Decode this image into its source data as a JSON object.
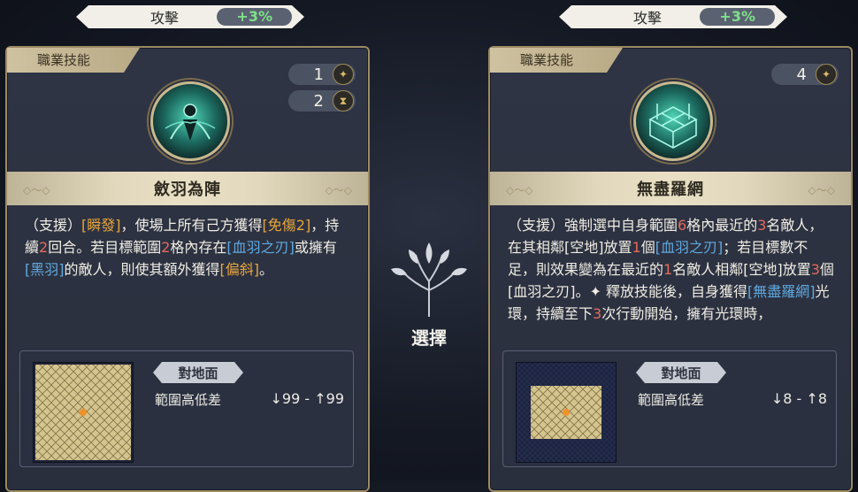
{
  "left_card": {
    "stat": {
      "name": "攻擊",
      "value": "+3%"
    },
    "category_label": "職業技能",
    "badges": [
      {
        "count": "1",
        "icon": "star-cost-icon"
      },
      {
        "count": "2",
        "icon": "hourglass-icon"
      }
    ],
    "skill_icon": "feather-array-skill-icon",
    "skill_name": "斂羽為陣",
    "description": [
      {
        "t": "（支援）",
        "c": ""
      },
      {
        "t": "[瞬發]",
        "c": "y"
      },
      {
        "t": "，使場上所有己方獲得",
        "c": ""
      },
      {
        "t": "[免傷2]",
        "c": "y"
      },
      {
        "t": "，持續",
        "c": ""
      },
      {
        "t": "2",
        "c": "r"
      },
      {
        "t": "回合。若目標範圍",
        "c": ""
      },
      {
        "t": "2",
        "c": "r"
      },
      {
        "t": "格內存在",
        "c": ""
      },
      {
        "t": "[血羽之刃]",
        "c": "b"
      },
      {
        "t": "或擁有",
        "c": ""
      },
      {
        "t": "[黑羽]",
        "c": "b"
      },
      {
        "t": "的敵人，則使其額外獲得",
        "c": ""
      },
      {
        "t": "[偏斜]",
        "c": "y"
      },
      {
        "t": "。",
        "c": ""
      }
    ],
    "range": {
      "terrain_label": "對地面",
      "height_label": "範圍高低差",
      "height_value": "↓99 - ↑99"
    }
  },
  "right_card": {
    "stat": {
      "name": "攻擊",
      "value": "+3%"
    },
    "category_label": "職業技能",
    "badges": [
      {
        "count": "4",
        "icon": "star-cost-icon"
      }
    ],
    "skill_icon": "net-cage-skill-icon",
    "skill_name": "無盡羅網",
    "description": [
      {
        "t": "（支援）強制選中自身範圍",
        "c": ""
      },
      {
        "t": "6",
        "c": "r"
      },
      {
        "t": "格內最近的",
        "c": ""
      },
      {
        "t": "3",
        "c": "r"
      },
      {
        "t": "名敵人，在其相鄰[空地]放置",
        "c": ""
      },
      {
        "t": "1",
        "c": "r"
      },
      {
        "t": "個",
        "c": ""
      },
      {
        "t": "[血羽之刃]",
        "c": "b"
      },
      {
        "t": "；若目標數不足，則效果變為在最近的",
        "c": ""
      },
      {
        "t": "1",
        "c": "r"
      },
      {
        "t": "名敵人相鄰[空地]放置",
        "c": ""
      },
      {
        "t": "3",
        "c": "r"
      },
      {
        "t": "個[血羽之刃]。",
        "c": ""
      },
      {
        "t": "✦ 釋放技能後，自身獲得",
        "c": ""
      },
      {
        "t": "[無盡羅網]",
        "c": "b"
      },
      {
        "t": "光環，持續至下",
        "c": ""
      },
      {
        "t": "3",
        "c": "r"
      },
      {
        "t": "次行動開始，擁有光環時，",
        "c": ""
      }
    ],
    "range": {
      "terrain_label": "對地面",
      "height_label": "範圍高低差",
      "height_value": "↓8 - ↑8"
    }
  },
  "center": {
    "icon": "tree-emblem-icon",
    "label": "選擇"
  },
  "colors": {
    "highlight_yellow": "#e7a63b",
    "highlight_blue": "#5fa9e0",
    "highlight_red": "#e46a5a",
    "stat_green": "#7fe08a",
    "card_border": "#9c8a63"
  }
}
